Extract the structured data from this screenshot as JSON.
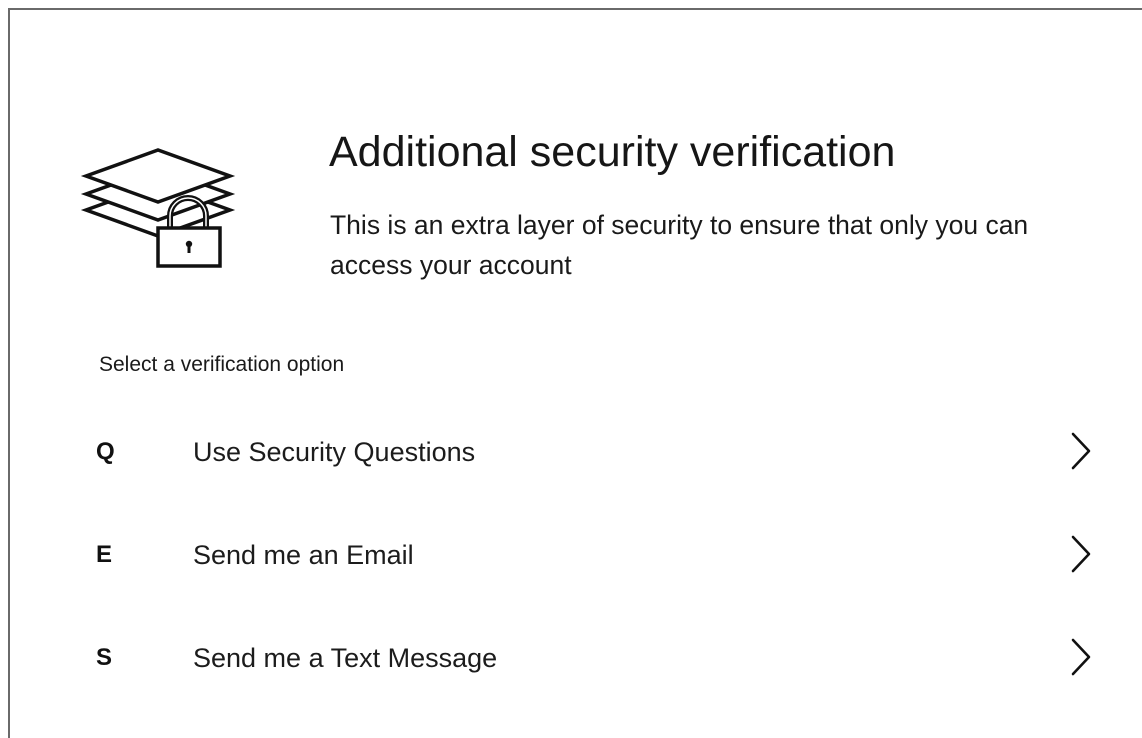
{
  "header": {
    "icon": "layers-lock-icon",
    "title": "Additional security verification",
    "subtitle": "This is an extra layer of security to ensure that only you can access your account"
  },
  "options_section": {
    "label": "Select a verification option",
    "items": [
      {
        "key": "Q",
        "label": "Use Security Questions",
        "icon": "chevron-right-icon"
      },
      {
        "key": "E",
        "label": "Send me an Email",
        "icon": "chevron-right-icon"
      },
      {
        "key": "S",
        "label": "Send me a Text Message",
        "icon": "chevron-right-icon"
      }
    ]
  },
  "colors": {
    "border": "#6a6a6a",
    "text": "#111111",
    "background": "#ffffff"
  }
}
